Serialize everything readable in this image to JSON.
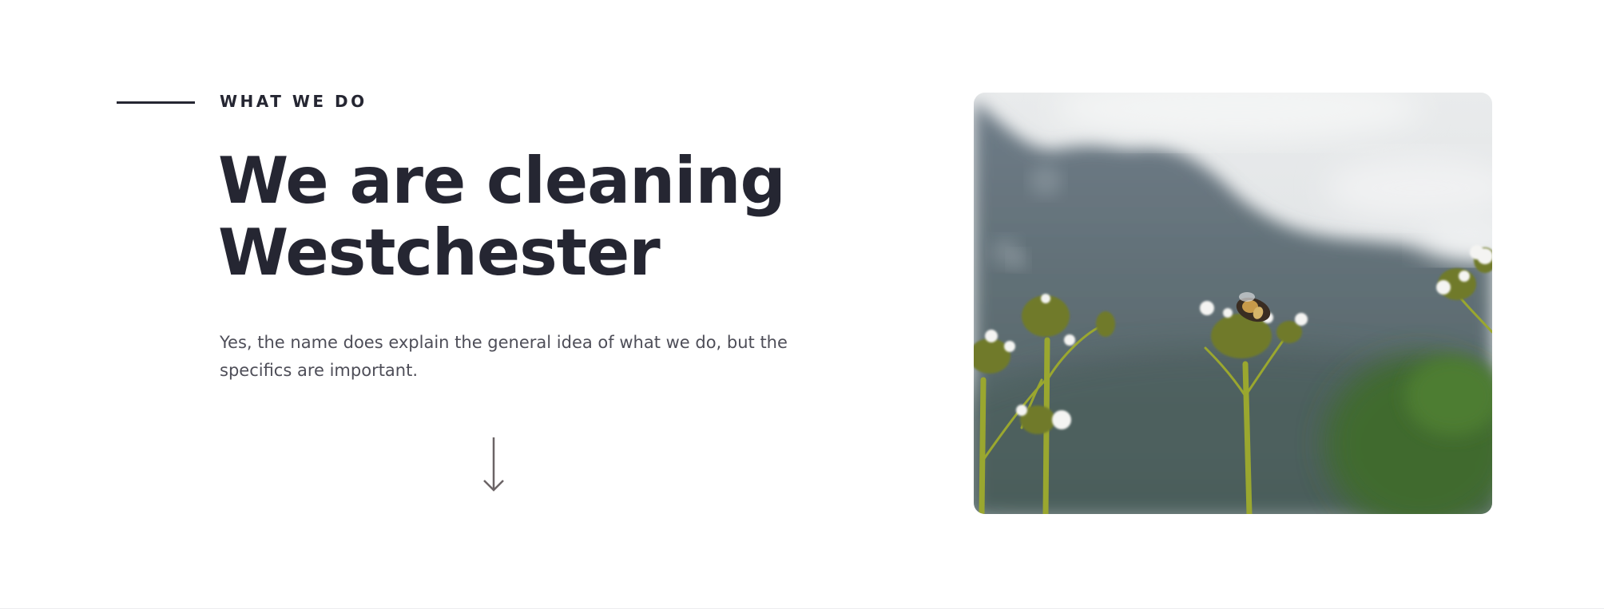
{
  "section": {
    "eyebrow": "WHAT WE DO",
    "headline_line1": "We are cleaning",
    "headline_line2": "Westchester",
    "description": "Yes, the name does explain the general idea of what we do, but the specifics are important."
  },
  "icons": {
    "scroll_arrow": "arrow-down-icon"
  },
  "image": {
    "subject": "bee on white wildflowers with blurred mountain background"
  },
  "colors": {
    "heading": "#252632",
    "body": "#4e4e58",
    "background": "#ffffff"
  }
}
